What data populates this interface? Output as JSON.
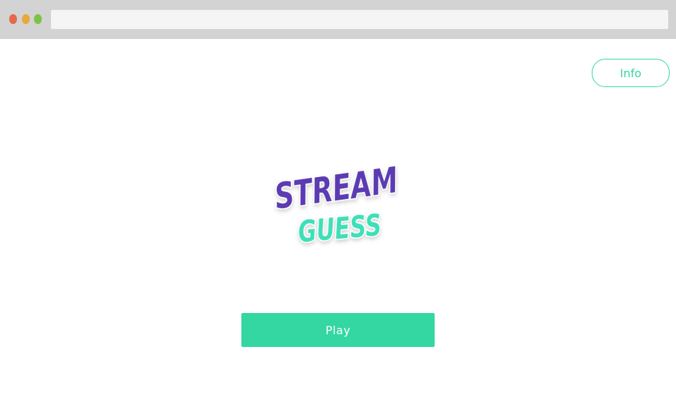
{
  "browser": {
    "window_controls": [
      "close",
      "minimize",
      "maximize"
    ],
    "address_bar": ""
  },
  "header": {
    "info_label": "Info"
  },
  "logo": {
    "line1": "STREAM",
    "line2": "GUESS",
    "line1_color": "#5b3ab2",
    "line2_color": "#3de0b8"
  },
  "main": {
    "play_label": "Play"
  },
  "colors": {
    "accent": "#34d6a2",
    "chrome": "#d3d3d3"
  }
}
